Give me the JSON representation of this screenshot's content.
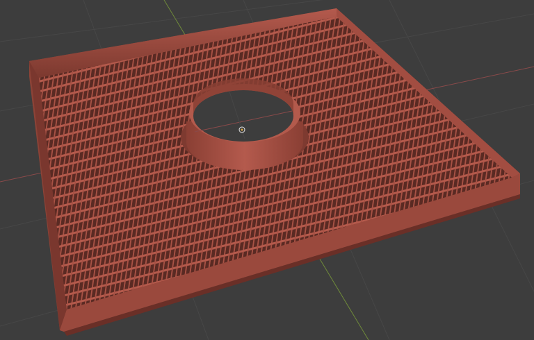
{
  "viewport": {
    "kind": "3D viewport",
    "background_color": "#3d3d3d",
    "grid_line_color": "#474747",
    "axis_x_color": "#8a4a4a",
    "axis_y_color": "#6f8a3a"
  },
  "object": {
    "type": "rectangular grate tray with central round collar",
    "material_color": "#9b4a3f",
    "shadow_color": "#5e2a24",
    "highlight_color": "#c56a5c"
  },
  "origin_marker": {
    "icon": "origin-crosshair-icon"
  }
}
